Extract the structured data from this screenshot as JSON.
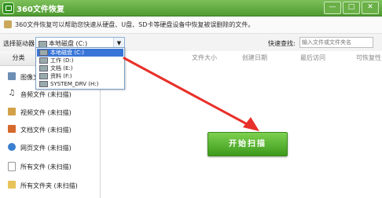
{
  "window": {
    "title": "360文件恢复",
    "controls": [
      "—",
      "□",
      "✕"
    ]
  },
  "info": {
    "text": "360文件恢复可以帮助您快速从硬盘、U盘、SD卡等硬盘设备中恢复被误删除的文件。"
  },
  "toolbar": {
    "drive_label": "选择驱动器",
    "drive_value": "本地磁盘 (C:)",
    "quick_search_label": "快速查找:",
    "search_placeholder": "输入文件或文件夹名"
  },
  "sidebar": {
    "header": "分类",
    "items": [
      {
        "label": "图像文件",
        "icon": "image-icon"
      },
      {
        "label": "音频文件 (未扫描)",
        "icon": "music-icon"
      },
      {
        "label": "视频文件 (未扫描)",
        "icon": "video-icon"
      },
      {
        "label": "文档文件 (未扫描)",
        "icon": "document-icon"
      },
      {
        "label": "网页文件 (未扫描)",
        "icon": "web-icon"
      },
      {
        "label": "所有文件 (未扫描)",
        "icon": "file-icon"
      },
      {
        "label": "所有文件夹 (未扫描)",
        "icon": "folder-icon"
      }
    ]
  },
  "table": {
    "columns": [
      "文件大小",
      "创建日期",
      "最后访问",
      "可恢复性"
    ]
  },
  "dropdown": {
    "options": [
      {
        "label": "本地磁盘 (C:)",
        "selected": true
      },
      {
        "label": "工作 (D:)"
      },
      {
        "label": "文档 (E:)"
      },
      {
        "label": "资料 (F:)"
      },
      {
        "label": "SYSTEM_DRV (H:)"
      }
    ]
  },
  "start_button": {
    "label": "开始扫描"
  },
  "colors": {
    "accent": "#4f9a31",
    "arrow": "#e8302a",
    "selection": "#3875d7"
  }
}
